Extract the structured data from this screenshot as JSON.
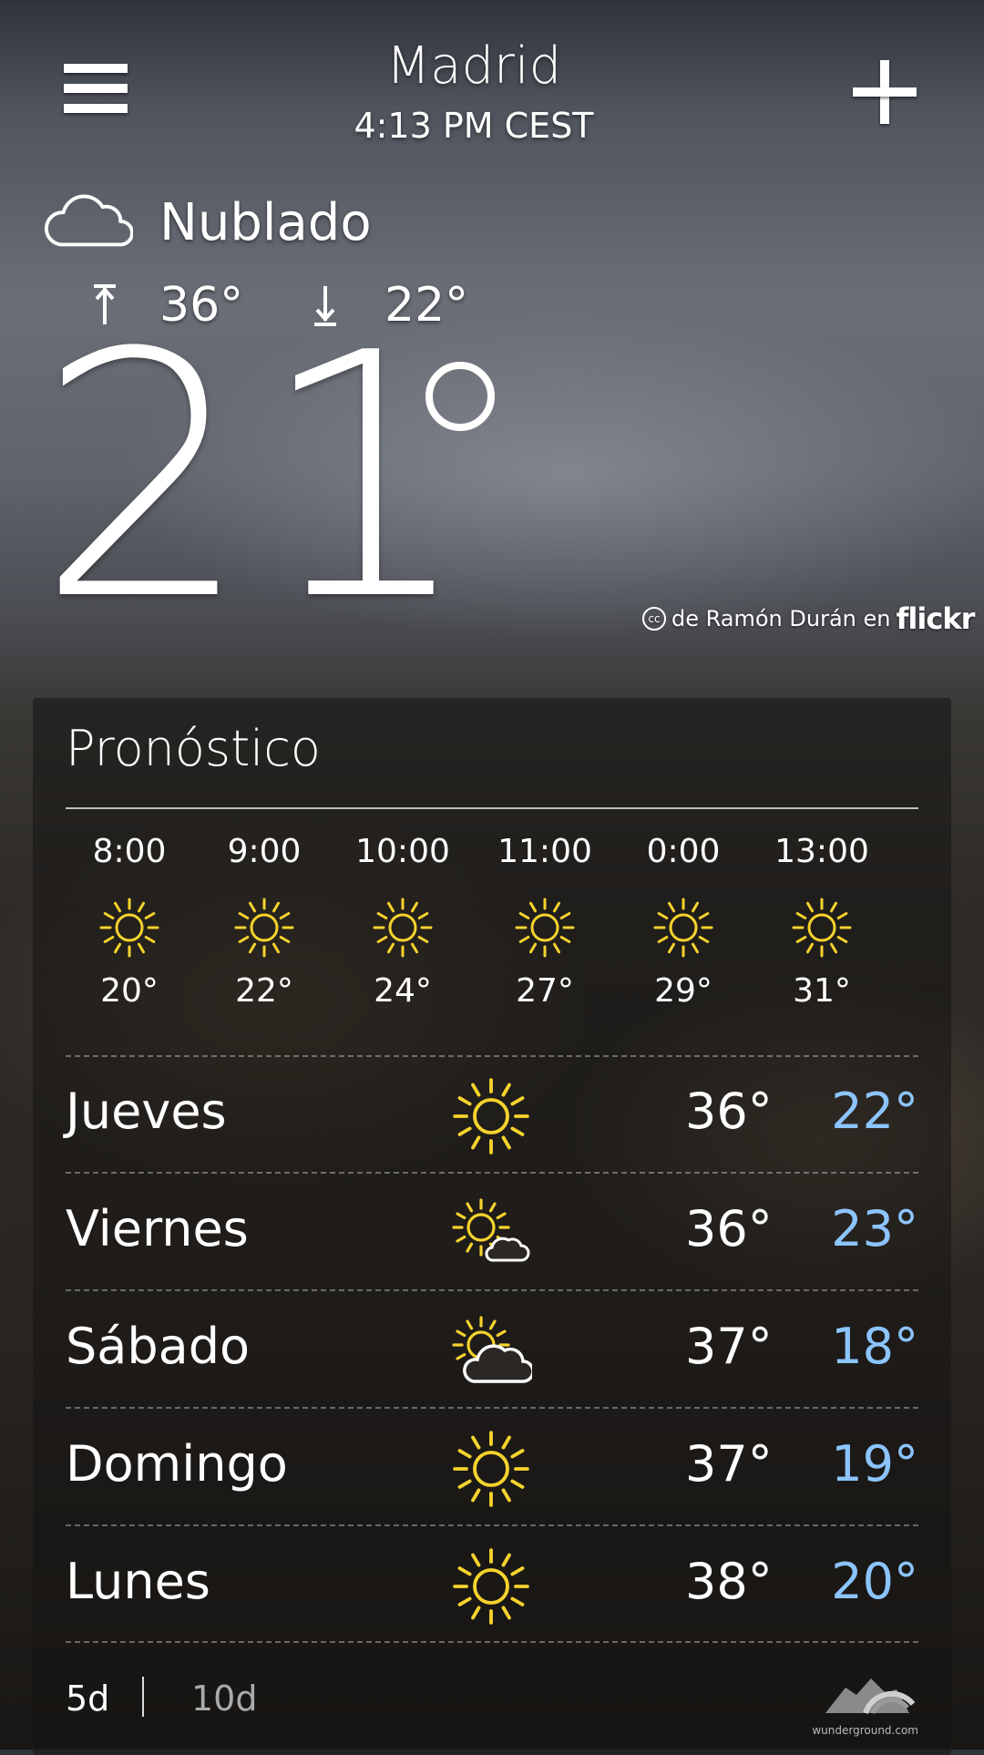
{
  "header": {
    "city": "Madrid",
    "time": "4:13 PM CEST",
    "menu_icon": "hamburger-menu-icon",
    "add_icon": "plus-icon"
  },
  "current": {
    "condition": "Nublado",
    "condition_icon": "cloud-icon",
    "high": "36°",
    "low": "22°",
    "temp": "21"
  },
  "photo_credit": {
    "text": "de Ramón Durán en",
    "brand": "flickr",
    "cc_badge": "cc"
  },
  "forecast": {
    "title": "Pronóstico",
    "hourly": [
      {
        "time": "8:00",
        "temp": "20°",
        "icon": "sun-icon"
      },
      {
        "time": "9:00",
        "temp": "22°",
        "icon": "sun-icon"
      },
      {
        "time": "10:00",
        "temp": "24°",
        "icon": "sun-icon"
      },
      {
        "time": "11:00",
        "temp": "27°",
        "icon": "sun-icon"
      },
      {
        "time": "0:00",
        "temp": "29°",
        "icon": "sun-icon"
      },
      {
        "time": "13:00",
        "temp": "31°",
        "icon": "sun-icon"
      }
    ],
    "daily": [
      {
        "day": "Jueves",
        "hi": "36°",
        "lo": "22°",
        "icon": "sun-icon"
      },
      {
        "day": "Viernes",
        "hi": "36°",
        "lo": "23°",
        "icon": "sun-small-cloud-icon"
      },
      {
        "day": "Sábado",
        "hi": "37°",
        "lo": "18°",
        "icon": "sun-cloud-icon"
      },
      {
        "day": "Domingo",
        "hi": "37°",
        "lo": "19°",
        "icon": "sun-icon"
      },
      {
        "day": "Lunes",
        "hi": "38°",
        "lo": "20°",
        "icon": "sun-icon"
      }
    ],
    "tabs": {
      "five_day": "5d",
      "ten_day": "10d"
    },
    "provider": "wunderground.com"
  },
  "colors": {
    "low_temp": "#8cc4ff",
    "sun": "#f6d32d"
  }
}
